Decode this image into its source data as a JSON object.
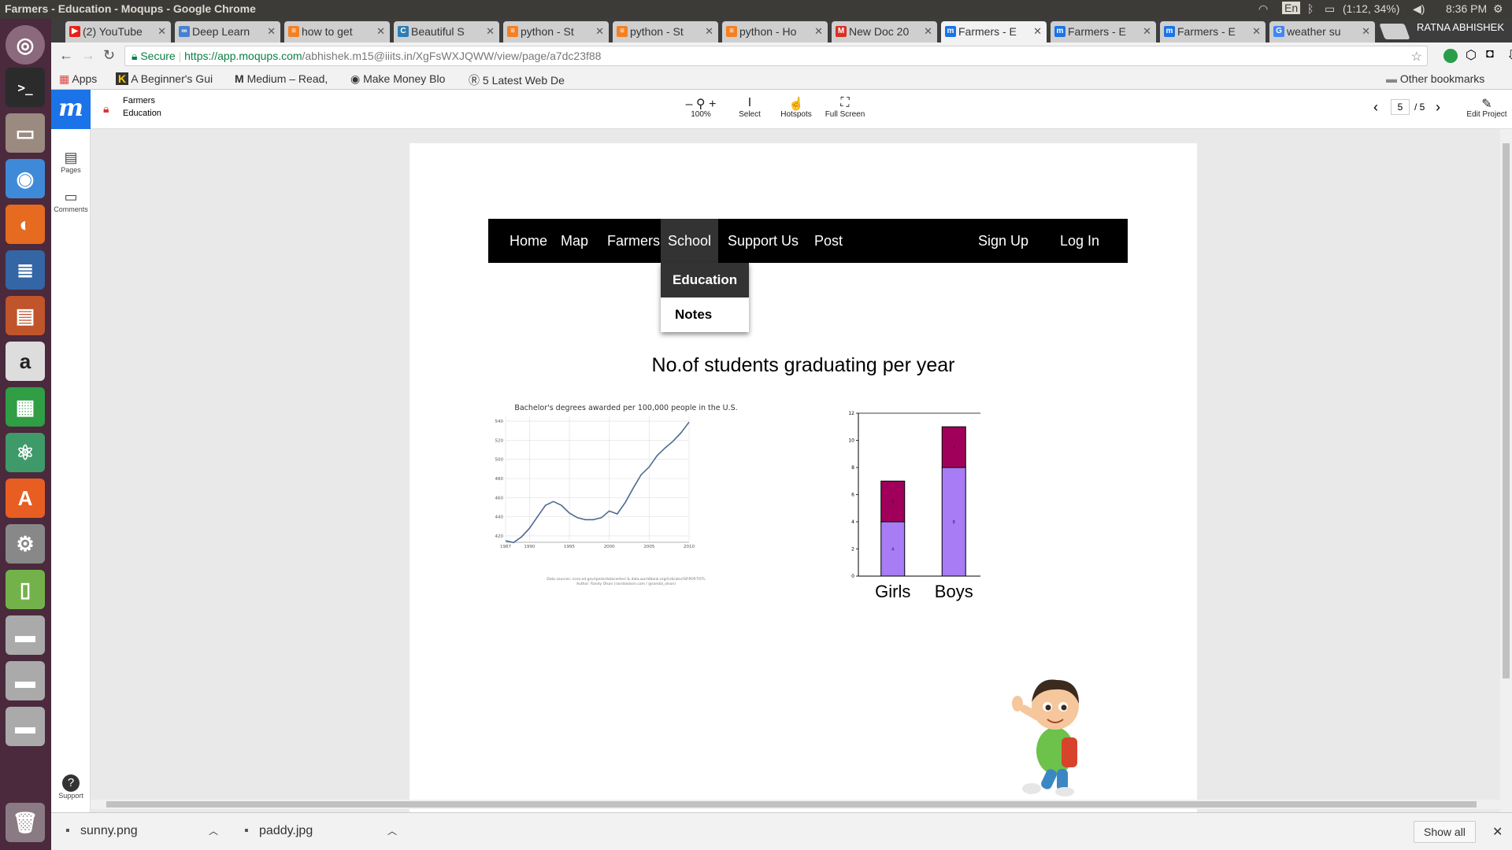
{
  "window_title": "Farmers - Education - Moqups - Google Chrome",
  "system": {
    "battery": "(1:12, 34%)",
    "time": "8:36 PM",
    "keyboard": "En",
    "user": "RATNA ABHISHEK"
  },
  "tabs": [
    {
      "label": "(2) YouTube",
      "fav_color": "#e62117",
      "fav": "▶"
    },
    {
      "label": "Deep Learn",
      "fav_color": "#4a7fd1",
      "fav": "∞"
    },
    {
      "label": "how to get",
      "fav_color": "#f48024",
      "fav": "≡"
    },
    {
      "label": "Beautiful S",
      "fav_color": "#2e7db5",
      "fav": "C"
    },
    {
      "label": "python - St",
      "fav_color": "#f48024",
      "fav": "≡"
    },
    {
      "label": "python - St",
      "fav_color": "#f48024",
      "fav": "≡"
    },
    {
      "label": "python - Ho",
      "fav_color": "#f48024",
      "fav": "≡"
    },
    {
      "label": "New Doc 20",
      "fav_color": "#d93025",
      "fav": "M"
    },
    {
      "label": "Farmers - E",
      "fav_color": "#1b73e8",
      "fav": "m",
      "active": true
    },
    {
      "label": "Farmers - E",
      "fav_color": "#1b73e8",
      "fav": "m"
    },
    {
      "label": "Farmers - E",
      "fav_color": "#1b73e8",
      "fav": "m"
    },
    {
      "label": "weather su",
      "fav_color": "#4285f4",
      "fav": "G"
    }
  ],
  "address": {
    "secure_label": "Secure",
    "url_host": "https://app.moqups.com",
    "url_path": "/abhishek.m15@iiits.in/XgFsWXJQWW/view/page/a7dc23f88"
  },
  "bookmarks": {
    "apps": "Apps",
    "items": [
      "A Beginner's Gui",
      "Medium – Read, ",
      "Make Money Blo",
      "5 Latest Web De"
    ],
    "other": "Other bookmarks"
  },
  "moqups": {
    "project": "Farmers",
    "page": "Education",
    "zoom": "100%",
    "select": "Select",
    "hotspots": "Hotspots",
    "fullscreen": "Full Screen",
    "page_num": "5",
    "page_total": "/ 5",
    "edit_project": "Edit Project",
    "left_pages": "Pages",
    "left_comments": "Comments",
    "left_support": "Support"
  },
  "site": {
    "nav": [
      "Home",
      "Map",
      "Farmers",
      "School",
      "Support Us",
      "Post"
    ],
    "signup": "Sign Up",
    "login": "Log In",
    "dropdown": [
      "Education",
      "Notes"
    ],
    "heading": "No.of students graduating per year"
  },
  "chart_data": [
    {
      "type": "line",
      "title": "Bachelor's degrees awarded per 100,000 people in the U.S.",
      "x_ticks": [
        "1987",
        "1990",
        "1995",
        "2000",
        "2005",
        "2010"
      ],
      "y_ticks": [
        "420",
        "440",
        "460",
        "480",
        "500",
        "520",
        "540"
      ],
      "ylim": [
        415,
        545
      ],
      "x": [
        1987,
        1988,
        1989,
        1990,
        1991,
        1992,
        1993,
        1994,
        1995,
        1996,
        1997,
        1998,
        1999,
        2000,
        2001,
        2002,
        2003,
        2004,
        2005,
        2006,
        2007,
        2008,
        2009,
        2010
      ],
      "values": [
        415,
        413,
        419,
        428,
        440,
        452,
        456,
        452,
        444,
        439,
        437,
        437,
        439,
        446,
        443,
        455,
        470,
        484,
        492,
        504,
        512,
        519,
        528,
        539
      ],
      "source": "Data sources: nces.ed.gov/ipeds/datacenter/ & data.worldbank.org/indicator/SP.POP.TOTL",
      "author": "Author: Randy Olson (randalolson.com / @randal_olson)",
      "grid": true
    },
    {
      "type": "bar",
      "stacked": true,
      "categories": [
        "Girls",
        "Boys"
      ],
      "series": [
        {
          "values": [
            4,
            8
          ],
          "color": "#a77cf5"
        },
        {
          "values": [
            3,
            3
          ],
          "color": "#a0005a"
        }
      ],
      "y_ticks": [
        "0",
        "2",
        "4",
        "6",
        "8",
        "10",
        "12"
      ],
      "ylim": [
        0,
        12
      ]
    }
  ],
  "downloads": [
    "sunny.png",
    "paddy.jpg"
  ],
  "show_all": "Show all"
}
